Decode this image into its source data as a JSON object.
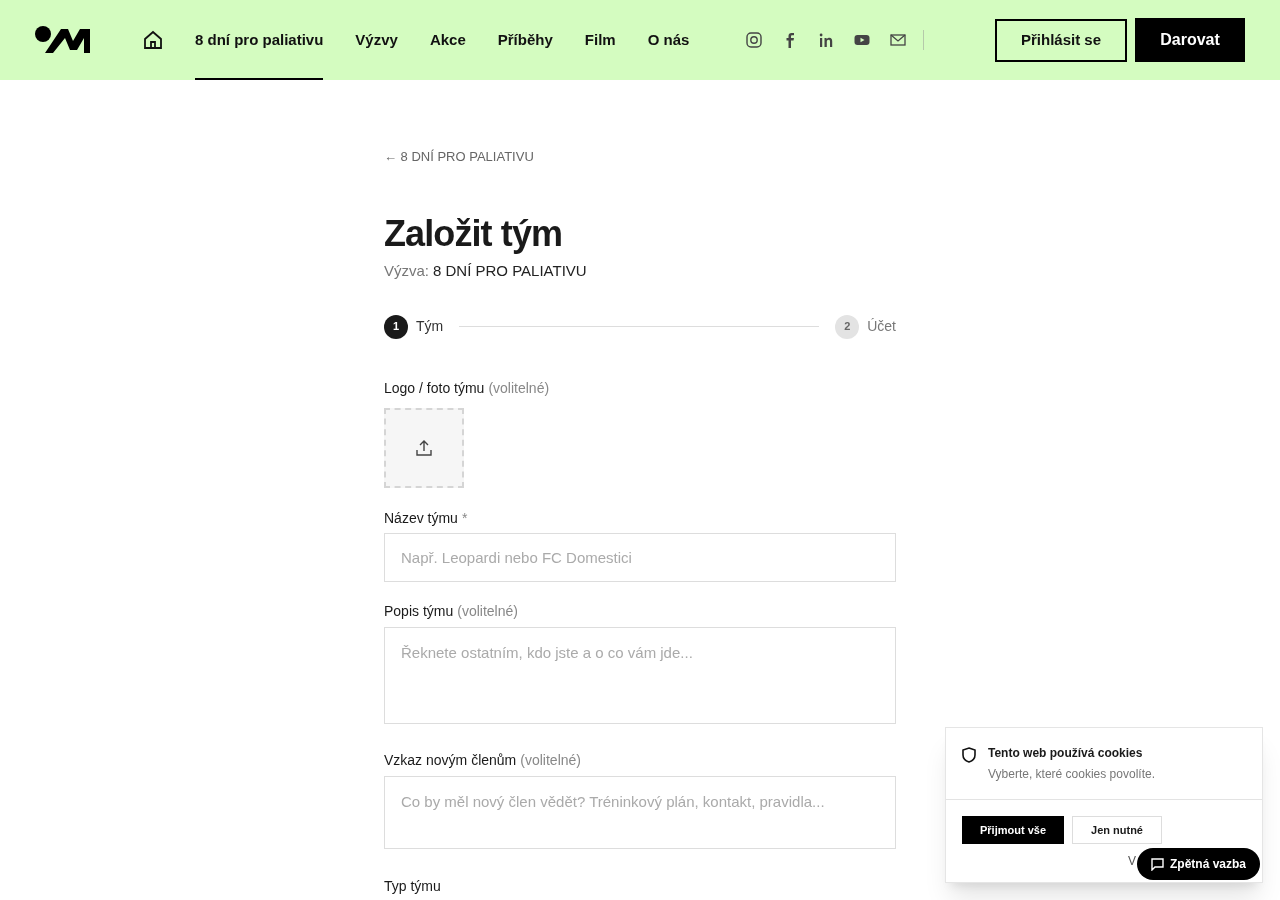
{
  "header": {
    "nav": [
      {
        "label": "8 dní pro paliativu",
        "selected": true
      },
      {
        "label": "Výzvy",
        "selected": false
      },
      {
        "label": "Akce",
        "selected": false
      },
      {
        "label": "Příběhy",
        "selected": false
      },
      {
        "label": "Film",
        "selected": false
      },
      {
        "label": "O nás",
        "selected": false
      }
    ],
    "social": [
      {
        "kind": "instagram"
      },
      {
        "kind": "facebook"
      },
      {
        "kind": "linkedin"
      },
      {
        "kind": "youtube"
      },
      {
        "kind": "email"
      }
    ],
    "login_button": "Přihlásit se",
    "donate_button": "Darovat"
  },
  "back_link": "← 8 DNÍ PRO PALIATIVU",
  "title": "Založit tým",
  "challenge": {
    "label": "Výzva:",
    "value": "8 DNÍ PRO PALIATIVU"
  },
  "steps": [
    {
      "number": "1",
      "label": "Tým",
      "selected": true
    },
    {
      "number": "2",
      "label": "Účet",
      "selected": false
    }
  ],
  "fields": [
    {
      "kind": "upload",
      "label": "Logo / foto týmu",
      "hint": "(volitelné)"
    },
    {
      "kind": "input",
      "label": "Název týmu",
      "required_mark": "*",
      "placeholder": "Např. Leopardi nebo FC Domestici"
    },
    {
      "kind": "textarea",
      "label": "Popis týmu",
      "hint": "(volitelné)",
      "placeholder": "Řeknete ostatním, kdo jste a o co vám jde..."
    },
    {
      "kind": "textarea_short",
      "label": "Vzkaz novým členům",
      "hint": "(volitelné)",
      "placeholder": "Co by měl nový člen vědět? Tréninkový plán, kontakt, pravidla..."
    },
    {
      "kind": "label",
      "label": "Typ týmu"
    }
  ],
  "cookies": {
    "title": "Tento web používá cookies",
    "text": "Vyberte, které cookies povolíte.",
    "accept_button": "Přijmout vše",
    "necessary_button": "Jen nutné",
    "more_link": "V"
  },
  "feedback_button": "Zpětná vazba"
}
